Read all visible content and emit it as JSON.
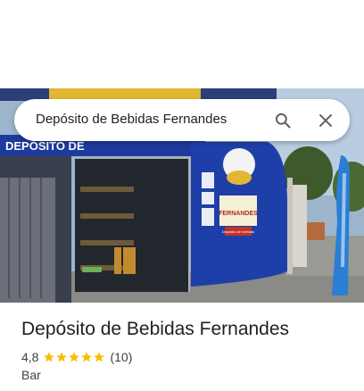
{
  "search": {
    "query": "Depósito de Bebidas Fernandes"
  },
  "place": {
    "name": "Depósito de Bebidas Fernandes",
    "rating": "4,8",
    "rating_value": 4.8,
    "star_count": 5,
    "review_count": "(10)",
    "category": "Bar"
  },
  "photo": {
    "sign_text": "FERNANDES",
    "sub_sign_text": "Depósito de bebidas",
    "wall_text": "DEPÓSITO DE"
  },
  "colors": {
    "star": "#fbbc04",
    "wall_blue": "#1f3fa8",
    "text_primary": "#202124",
    "text_secondary": "#3c4043"
  }
}
